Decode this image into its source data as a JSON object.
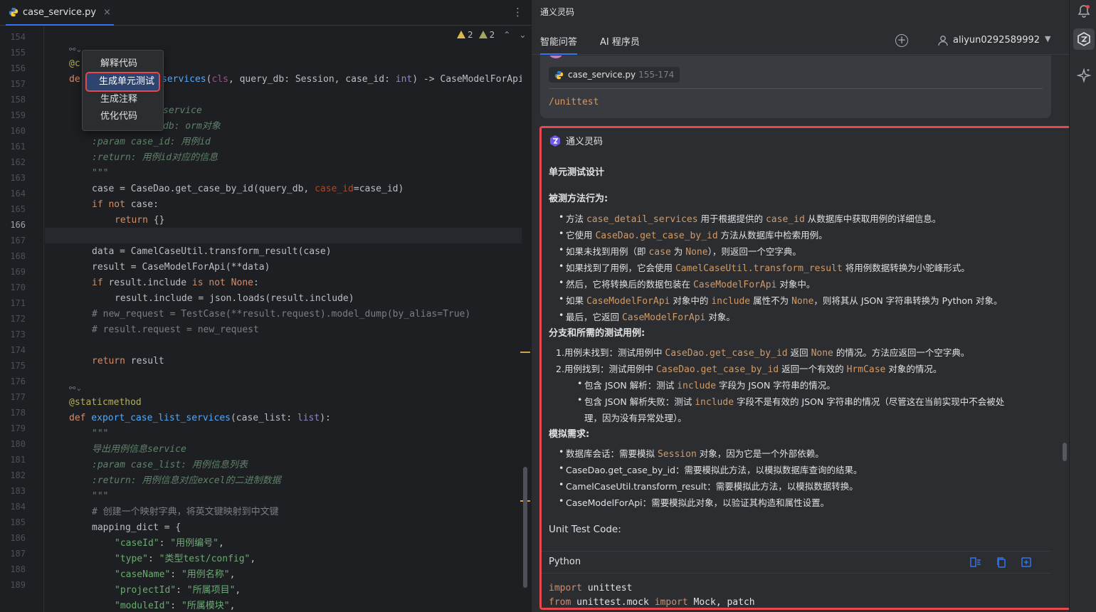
{
  "editor": {
    "tab_label": "case_service.py",
    "tab_close": "×",
    "more": "⋮",
    "inspections": {
      "warnings": "2",
      "weak_warnings": "2"
    },
    "line_numbers": [
      "154",
      "155",
      "156",
      "157",
      "158",
      "159",
      "160",
      "161",
      "162",
      "163",
      "164",
      "165",
      "166",
      "167",
      "168",
      "169",
      "170",
      "171",
      "172",
      "173",
      "174",
      "175",
      "176",
      "177",
      "178",
      "179",
      "180",
      "181",
      "182",
      "183",
      "184",
      "185",
      "186",
      "187",
      "188",
      "189"
    ],
    "current_line": "166",
    "hints": [
      "⚯⌄",
      "⚯⌄"
    ],
    "lines": {
      "l155": [
        "@c"
      ],
      "l156a": "de",
      "l156b": "services",
      "l156c": "(cls, query_db: Session, case_id: int) -> CaseModelForApi",
      "l158": "service",
      "l159": "db: orm对象",
      "l160": ":param case_id: 用例id",
      "l161": ":return: 用例id对应的信息",
      "l162": "\"\"\"",
      "l163": "case = CaseDao.get_case_by_id(query_db, case_id=case_id)",
      "l164a": "if not",
      "l164b": " case:",
      "l165a": "return",
      "l165b": " {}",
      "l167": "data = CamelCaseUtil.transform_result(case)",
      "l168": "result = CaseModelForApi(**data)",
      "l169a": "if",
      "l169b": " result.include ",
      "l169c": "is not",
      "l169d": " None",
      "l169e": ":",
      "l170": "result.include = json.loads(result.include)",
      "l171": "# new_request = TestCase(**result.request).model_dump(by_alias=True)",
      "l172": "# result.request = new_request",
      "l174a": "return",
      "l174b": " result",
      "l176": "@staticmethod",
      "l177a": "def",
      "l177b": " export_case_list_services",
      "l177c": "(case_list: ",
      "l177d": "list",
      "l177e": "):",
      "l178": "\"\"\"",
      "l179": "导出用例信息service",
      "l180": ":param case_list: 用例信息列表",
      "l181": ":return: 用例信息对应excel的二进制数据",
      "l182": "\"\"\"",
      "l183": "# 创建一个映射字典，将英文键映射到中文键",
      "l184": "mapping_dict = {",
      "l185a": "\"caseId\"",
      "l185b": "\"用例编号\"",
      "l186a": "\"type\"",
      "l186b": "\"类型test/config\"",
      "l187a": "\"caseName\"",
      "l187b": "\"用例名称\"",
      "l188a": "\"projectId\"",
      "l188b": "\"所属项目\"",
      "l189a": "\"moduleId\"",
      "l189b": "\"所属模块\""
    },
    "popup": {
      "items": [
        "解释代码",
        "生成单元测试",
        "生成注释",
        "优化代码"
      ],
      "selected_index": 1
    }
  },
  "panel": {
    "title": "通义灵码",
    "tabs": [
      "智能问答",
      "AI 程序员"
    ],
    "user": "aliyun0292589992",
    "user_message": {
      "context_file": "case_service.py",
      "context_range": "155-174",
      "command": "/unittest"
    },
    "answer": {
      "bot_name": "通义灵码",
      "heading": "单元测试设计",
      "section1_title": "被测方法行为:",
      "section1": [
        [
          "方法 ",
          "case_detail_services",
          " 用于根据提供的 ",
          "case_id",
          " 从数据库中获取用例的详细信息。"
        ],
        [
          "它使用 ",
          "CaseDao.get_case_by_id",
          " 方法从数据库中检索用例。"
        ],
        [
          "如果未找到用例（即 ",
          "case",
          " 为 ",
          "None",
          "），则返回一个空字典。"
        ],
        [
          "如果找到了用例，它会使用 ",
          "CamelCaseUtil.transform_result",
          " 将用例数据转换为小驼峰形式。"
        ],
        [
          "然后，它将转换后的数据包装在 ",
          "CaseModelForApi",
          " 对象中。"
        ],
        [
          "如果 ",
          "CaseModelForApi",
          " 对象中的 ",
          "include",
          " 属性不为 ",
          "None",
          "，则将其从 JSON 字符串转换为 Python 对象。"
        ],
        [
          "最后，它返回 ",
          "CaseModelForApi",
          " 对象。"
        ]
      ],
      "section2_title": "分支和所需的测试用例:",
      "section2": [
        [
          "1.",
          "用例未找到：测试用例中 ",
          "CaseDao.get_case_by_id",
          " 返回 ",
          "None",
          " 的情况。方法应返回一个空字典。"
        ],
        [
          "2.",
          "用例找到：测试用例中 ",
          "CaseDao.get_case_by_id",
          " 返回一个有效的 ",
          "HrmCase",
          " 对象的情况。"
        ]
      ],
      "section2_sub": [
        [
          "包含 JSON 解析：测试 ",
          "include",
          " 字段为 JSON 字符串的情况。"
        ],
        [
          "包含 JSON 解析失败：测试 ",
          "include",
          " 字段不是有效的 JSON 字符串的情况（尽管这在当前实现中不会被处",
          "理，因为没有异常处理）。"
        ]
      ],
      "section3_title": "模拟需求:",
      "section3": [
        [
          "数据库会话：需要模拟 ",
          "Session",
          " 对象，因为它是一个外部依赖。"
        ],
        [
          "CaseDao.get_case_by_id",
          "：需要模拟此方法，以模拟数据库查询的结果。"
        ],
        [
          "CamelCaseUtil.transform_result",
          "：需要模拟此方法，以模拟数据转换。"
        ],
        [
          "CaseModelForApi",
          "：需要模拟此对象，以验证其构造和属性设置。"
        ]
      ],
      "code_title": "Unit Test Code:",
      "code_lang": "Python",
      "code_lines": [
        [
          "import",
          " unittest"
        ],
        [
          "from",
          " unittest.mock ",
          "import",
          " Mock, patch"
        ]
      ]
    }
  },
  "colors": {
    "accent": "#3574f0",
    "highlight_border": "#e5484d",
    "inline_code": "#d19a66"
  }
}
